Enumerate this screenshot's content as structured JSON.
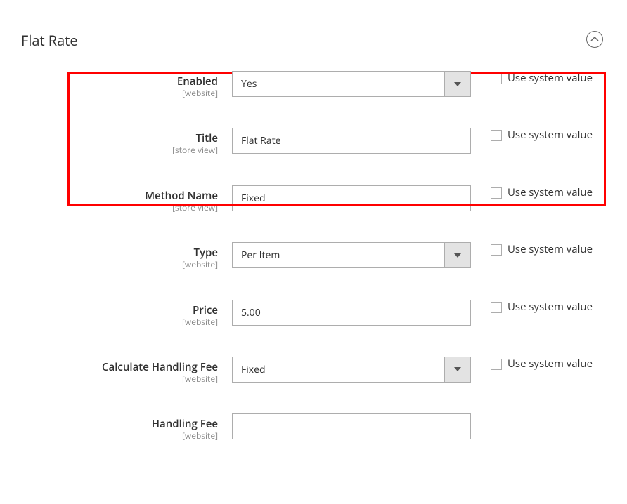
{
  "section": {
    "title": "Flat Rate"
  },
  "scope": {
    "website": "[website]",
    "store_view": "[store view]"
  },
  "use_system_value": "Use system value",
  "fields": {
    "enabled": {
      "label": "Enabled",
      "value": "Yes"
    },
    "title": {
      "label": "Title",
      "value": "Flat Rate"
    },
    "method_name": {
      "label": "Method Name",
      "value": "Fixed"
    },
    "type": {
      "label": "Type",
      "value": "Per Item"
    },
    "price": {
      "label": "Price",
      "value": "5.00"
    },
    "calc_fee": {
      "label": "Calculate Handling Fee",
      "value": "Fixed"
    },
    "handling_fee": {
      "label": "Handling Fee",
      "value": ""
    }
  }
}
